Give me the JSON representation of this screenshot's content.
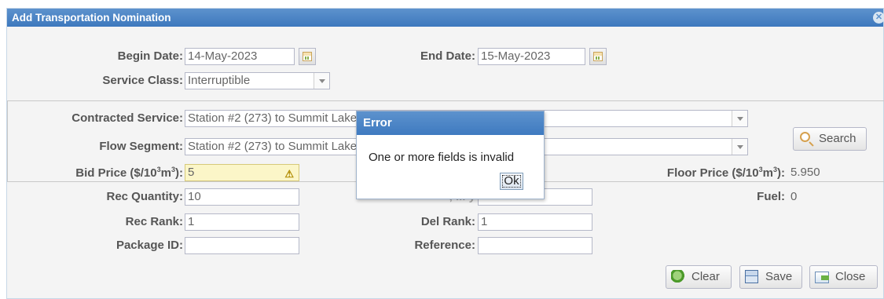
{
  "window": {
    "title": "Add Transportation Nomination",
    "close_glyph": "✕"
  },
  "form": {
    "begin_date_label": "Begin Date:",
    "begin_date_value": "14-May-2023",
    "end_date_label": "End Date:",
    "end_date_value": "15-May-2023",
    "service_class_label": "Service Class:",
    "service_class_value": "Interruptible",
    "contracted_service_label": "Contracted Service:",
    "contracted_service_value": "Station #2 (273) to Summit Lake (636) TSPNG",
    "flow_segment_label": "Flow Segment:",
    "flow_segment_value": "Station #2 (273) to Summit Lake (636)",
    "bid_price_label_prefix": "Bid Price ($/10",
    "bid_price_label_sup1": "3",
    "bid_price_label_mid": "m",
    "bid_price_label_sup2": "3",
    "bid_price_label_suffix": "):",
    "bid_price_value": "5",
    "floor_price_label_prefix": "Floor Price ($/10",
    "floor_price_label_sup1": "3",
    "floor_price_label_mid": "m",
    "floor_price_label_sup2": "3",
    "floor_price_label_suffix": "):",
    "floor_price_value": "5.950",
    "rec_quantity_label": "Rec Quantity:",
    "rec_quantity_value": "10",
    "del_quantity_label_partial": ", ... y",
    "fuel_label": "Fuel:",
    "fuel_value": "0",
    "rec_rank_label": "Rec Rank:",
    "rec_rank_value": "1",
    "del_rank_label": "Del Rank:",
    "del_rank_value": "1",
    "package_id_label": "Package ID:",
    "package_id_value": "",
    "reference_label": "Reference:",
    "reference_value": ""
  },
  "buttons": {
    "search": "Search",
    "clear": "Clear",
    "save": "Save",
    "close": "Close"
  },
  "dialog": {
    "title": "Error",
    "message": "One or more fields is invalid",
    "ok": "Ok"
  },
  "icons": {
    "calendar": "calendar-icon",
    "dropdown": "chevron-down-icon",
    "warning": "warning-icon",
    "search": "search-icon",
    "clear": "refresh-icon",
    "save": "floppy-icon",
    "close": "close-window-icon"
  },
  "colors": {
    "titlebar": "#4a85c7",
    "invalid_field": "#fbf6c8",
    "panel": "#f4f4f4"
  }
}
